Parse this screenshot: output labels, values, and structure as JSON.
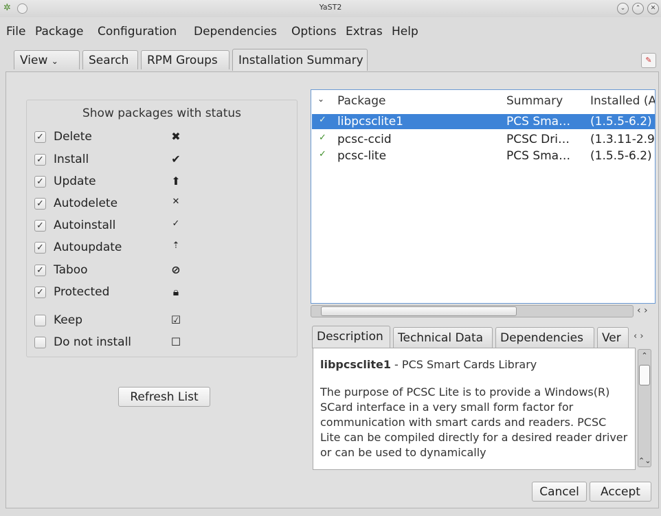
{
  "window": {
    "title": "YaST2"
  },
  "menu": [
    "File",
    "Package",
    "Configuration",
    "Dependencies",
    "Options",
    "Extras",
    "Help"
  ],
  "top_tabs": {
    "view": "View",
    "search": "Search",
    "rpm_groups": "RPM Groups",
    "summary": "Installation Summary"
  },
  "filter": {
    "title": "Show packages with status",
    "items": [
      {
        "label": "Delete",
        "checked": true,
        "icon": "delete-icon"
      },
      {
        "label": "Install",
        "checked": true,
        "icon": "install-icon"
      },
      {
        "label": "Update",
        "checked": true,
        "icon": "update-icon"
      },
      {
        "label": "Autodelete",
        "checked": true,
        "icon": "autodelete-icon"
      },
      {
        "label": "Autoinstall",
        "checked": true,
        "icon": "autoinstall-icon"
      },
      {
        "label": "Autoupdate",
        "checked": true,
        "icon": "autoupdate-icon"
      },
      {
        "label": "Taboo",
        "checked": true,
        "icon": "taboo-icon"
      },
      {
        "label": "Protected",
        "checked": true,
        "icon": "lock-icon"
      },
      {
        "label": "Keep",
        "checked": false,
        "icon": "keep-icon"
      },
      {
        "label": "Do not install",
        "checked": false,
        "icon": "do-not-install-icon"
      }
    ],
    "refresh_label": "Refresh List"
  },
  "package_table": {
    "columns": [
      "Package",
      "Summary",
      "Installed (A"
    ],
    "rows": [
      {
        "package": "libpcsclite1",
        "summary": "PCS Sma…",
        "installed": "(1.5.5-6.2)",
        "selected": true
      },
      {
        "package": "pcsc-ccid",
        "summary": "PCSC Dri…",
        "installed": "(1.3.11-2.9",
        "selected": false
      },
      {
        "package": "pcsc-lite",
        "summary": "PCS Sma…",
        "installed": "(1.5.5-6.2)",
        "selected": false
      }
    ]
  },
  "detail_tabs": {
    "description": "Description",
    "technical": "Technical Data",
    "dependencies": "Dependencies",
    "versions": "Ver"
  },
  "description": {
    "package_name": "libpcsclite1",
    "summary": " - PCS Smart Cards Library",
    "body": "The purpose of PCSC Lite is to provide a Windows(R) SCard interface in a very small form factor for communication with smart cards and readers. PCSC Lite can be compiled directly for a desired reader driver or can be used to dynamically"
  },
  "buttons": {
    "cancel": "Cancel",
    "accept": "Accept"
  }
}
